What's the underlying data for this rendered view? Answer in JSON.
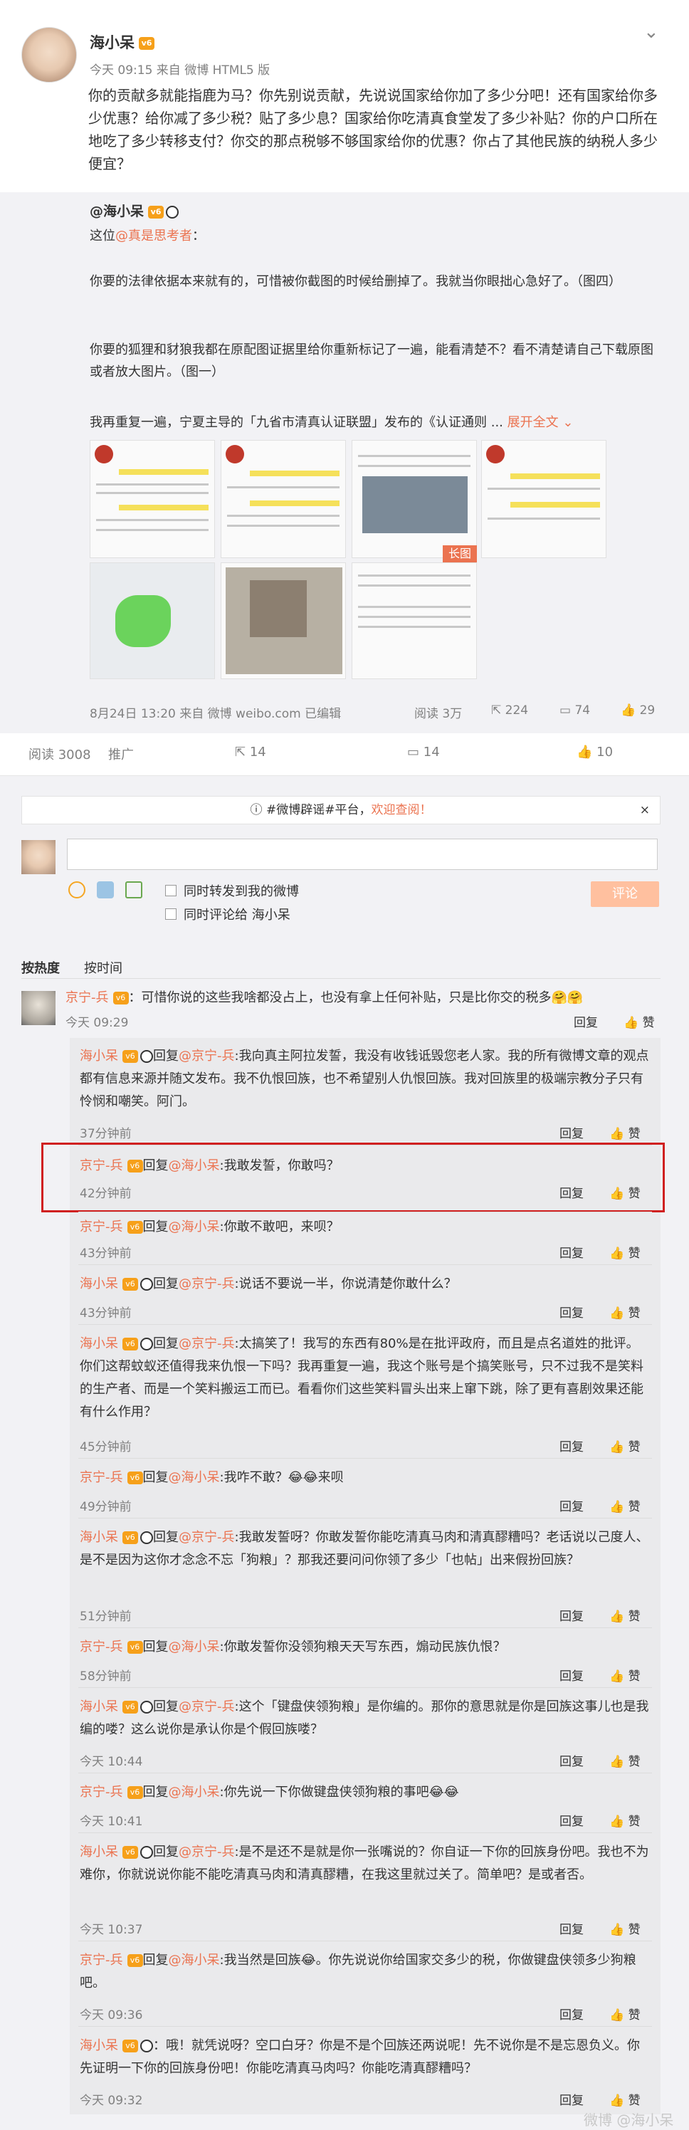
{
  "post": {
    "author": "海小呆",
    "vip_badge": "v6",
    "meta": "今天 09:15 来自 微博 HTML5 版",
    "text": "你的贡献多就能指鹿为马？你先别说贡献，先说说国家给你加了多少分吧！还有国家给你多少优惠？给你减了多少税？贴了多少息？国家给你吃清真食堂发了多少补贴？你的户口所在地吃了多少转移支付？你交的那点税够不够国家给你的优惠？你占了其他民族的纳税人多少便宜？"
  },
  "repost": {
    "user": "@海小呆",
    "p1_prefix": "这位",
    "p1_mention": "@真是思考者",
    "p1_suffix": "：",
    "p2": "你要的法律依据本来就有的，可惜被你截图的时候给删掉了。我就当你眼拙心急好了。（图四）",
    "p3": "你要的狐狸和豺狼我都在原配图证据里给你重新标记了一遍，能看清楚不？看不清楚请自己下载原图或者放大图片。（图一）",
    "p4": "我再重复一遍，宁夏主导的「九省市清真认证联盟」发布的《认证通则 ...",
    "expand": "展开全文 ⌄",
    "long_image": "长图",
    "footer": "8月24日 13:20 来自 微博 weibo.com  已编辑",
    "reads": "阅读 3万",
    "reposts": "224",
    "comments": "74",
    "likes": "29"
  },
  "actions": {
    "reads": "阅读 3008",
    "promote": "推广",
    "reposts": "14",
    "comments": "14",
    "likes": "10"
  },
  "notice": {
    "text": "#微博辟谣#平台，",
    "link": "欢迎查阅！",
    "close": "×"
  },
  "composer": {
    "chk1": "同时转发到我的微博",
    "chk2": "同时评论给 海小呆",
    "submit": "评论"
  },
  "sort": {
    "hot": "按热度",
    "time": "按时间"
  },
  "labels": {
    "reply_prefix": "回复",
    "reply": "回复",
    "like": "赞"
  },
  "comments": [
    {
      "user": "京宁-兵",
      "text": "：可惜你说的这些我啥都没占上，也没有拿上任何补贴，只是比你交的税多🤗🤗",
      "time": "今天 09:29"
    }
  ],
  "replies": [
    {
      "user": "海小呆",
      "to": "@京宁-兵",
      "text": ":我向真主阿拉发誓，我没有收钱诋毁您老人家。我的所有微博文章的观点都有信息来源并随文发布。我不仇恨回族，也不希望别人仇恨回族。我对回族里的极端宗教分子只有怜悯和嘲笑。阿门。",
      "time": "37分钟前"
    },
    {
      "user": "京宁-兵",
      "to": "@海小呆",
      "text": ":我敢发誓，你敢吗？",
      "time": "42分钟前"
    },
    {
      "user": "京宁-兵",
      "to": "@海小呆",
      "text": ":你敢不敢吧，来呗？",
      "time": "43分钟前"
    },
    {
      "user": "海小呆",
      "to": "@京宁-兵",
      "text": ":说话不要说一半，你说清楚你敢什么？",
      "time": "43分钟前"
    },
    {
      "user": "海小呆",
      "to": "@京宁-兵",
      "text": ":太搞笑了！我写的东西有80%是在批评政府，而且是点名道姓的批评。你们这帮蚊蚁还值得我来仇恨一下吗？我再重复一遍，我这个账号是个搞笑账号，只不过我不是笑料的生产者、而是一个笑料搬运工而已。看看你们这些笑料冒头出来上窜下跳，除了更有喜剧效果还能有什么作用？",
      "time": "45分钟前"
    },
    {
      "user": "京宁-兵",
      "to": "@海小呆",
      "text": ":我咋不敢？😂😂来呗",
      "time": "49分钟前"
    },
    {
      "user": "海小呆",
      "to": "@京宁-兵",
      "text": ":我敢发誓呀？你敢发誓你能吃清真马肉和清真醪糟吗？老话说以己度人、是不是因为这你才念念不忘「狗粮」？那我还要问问你领了多少「也帖」出来假扮回族？",
      "time": "51分钟前"
    },
    {
      "user": "京宁-兵",
      "to": "@海小呆",
      "text": ":你敢发誓你没领狗粮天天写东西，煽动民族仇恨？",
      "time": "58分钟前"
    },
    {
      "user": "海小呆",
      "to": "@京宁-兵",
      "text": ":这个「键盘侠领狗粮」是你编的。那你的意思就是你是回族这事儿也是我编的喽？这么说你是承认你是个假回族喽？",
      "time": "今天 10:44"
    },
    {
      "user": "京宁-兵",
      "to": "@海小呆",
      "text": ":你先说一下你做键盘侠领狗粮的事吧😂😂",
      "time": "今天 10:41"
    },
    {
      "user": "海小呆",
      "to": "@京宁-兵",
      "text": ":是不是还不是就是你一张嘴说的？你自证一下你的回族身份吧。我也不为难你，你就说说你能不能吃清真马肉和清真醪糟，在我这里就过关了。简单吧？是或者否。",
      "time": "今天 10:37"
    },
    {
      "user": "京宁-兵",
      "to": "@海小呆",
      "text": ":我当然是回族😂。你先说说你给国家交多少的税，你做键盘侠领多少狗粮吧。",
      "time": "今天 09:36"
    },
    {
      "user": "海小呆",
      "to": "",
      "text": "：哦！就凭说呀？空口白牙？你是不是个回族还两说呢！先不说你是不是忘恩负义。你先证明一下你的回族身份吧！你能吃清真马肉吗？你能吃清真醪糟吗？",
      "time": "今天 09:32"
    }
  ],
  "watermark": "微博 @海小呆",
  "colors": {
    "link": "#eb7350",
    "accent_button": "#ffc09f",
    "highlight_box": "#d02020"
  }
}
